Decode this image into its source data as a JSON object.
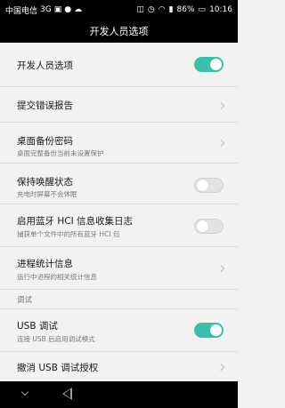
{
  "status_bar": {
    "carrier": "中国电信",
    "network": "3G",
    "battery": "86%",
    "time": "10:16",
    "icons": [
      "notification-icon",
      "image-icon",
      "cloud-icon",
      "vibrate-icon",
      "alarm-icon",
      "wifi-icon",
      "signal-icon",
      "battery-icon"
    ]
  },
  "app_bar": {
    "title": "开发人员选项"
  },
  "settings": {
    "developer_options": {
      "title": "开发人员选项",
      "enabled": true
    },
    "bug_report": {
      "title": "提交错误报告"
    },
    "backup_password": {
      "title": "桌面备份密码",
      "subtitle": "桌面完整备份当前未设置保护"
    },
    "stay_awake": {
      "title": "保持唤醒状态",
      "subtitle": "充电时屏幕不会休眠",
      "enabled": false
    },
    "hci_log": {
      "title": "启用蓝牙 HCI 信息收集日志",
      "subtitle": "捕获单个文件中的所有蓝牙 HCI 包",
      "enabled": false
    },
    "process_stats": {
      "title": "进程统计信息",
      "subtitle": "运行中进程的相关统计信息"
    },
    "section_debug": {
      "label": "调试"
    },
    "usb_debugging": {
      "title": "USB 调试",
      "subtitle": "连接 USB 后启用调试模式",
      "enabled": true
    },
    "revoke_usb": {
      "title": "撤消 USB 调试授权"
    }
  },
  "colors": {
    "accent": "#3bbfad",
    "background": "#f2f2f2",
    "bar": "#000000"
  }
}
